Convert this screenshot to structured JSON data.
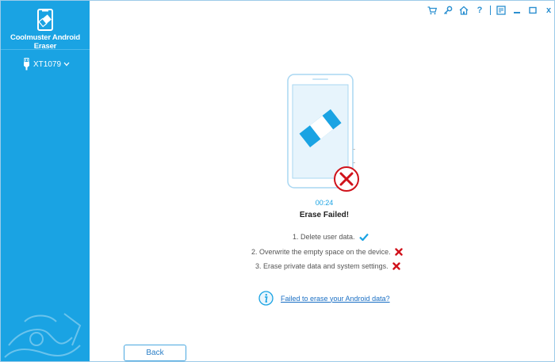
{
  "app": {
    "title": "Coolmuster Android Eraser"
  },
  "sidebar": {
    "device": {
      "label": "XT1079"
    }
  },
  "titlebar": {
    "close_label": "x"
  },
  "main": {
    "timer": "00:24",
    "status_title": "Erase Failed!",
    "steps": [
      {
        "label": "1. Delete user data.",
        "status": "success"
      },
      {
        "label": "2. Overwrite the empty space on the device.",
        "status": "failed"
      },
      {
        "label": "3. Erase private data and system settings.",
        "status": "failed"
      }
    ],
    "help_link": "Failed to erase your Android data?",
    "back_label": "Back"
  },
  "colors": {
    "sidebar": "#1aa3e3",
    "accent": "#1aa3e3",
    "error": "#d0121b",
    "link": "#1a6fc4"
  }
}
